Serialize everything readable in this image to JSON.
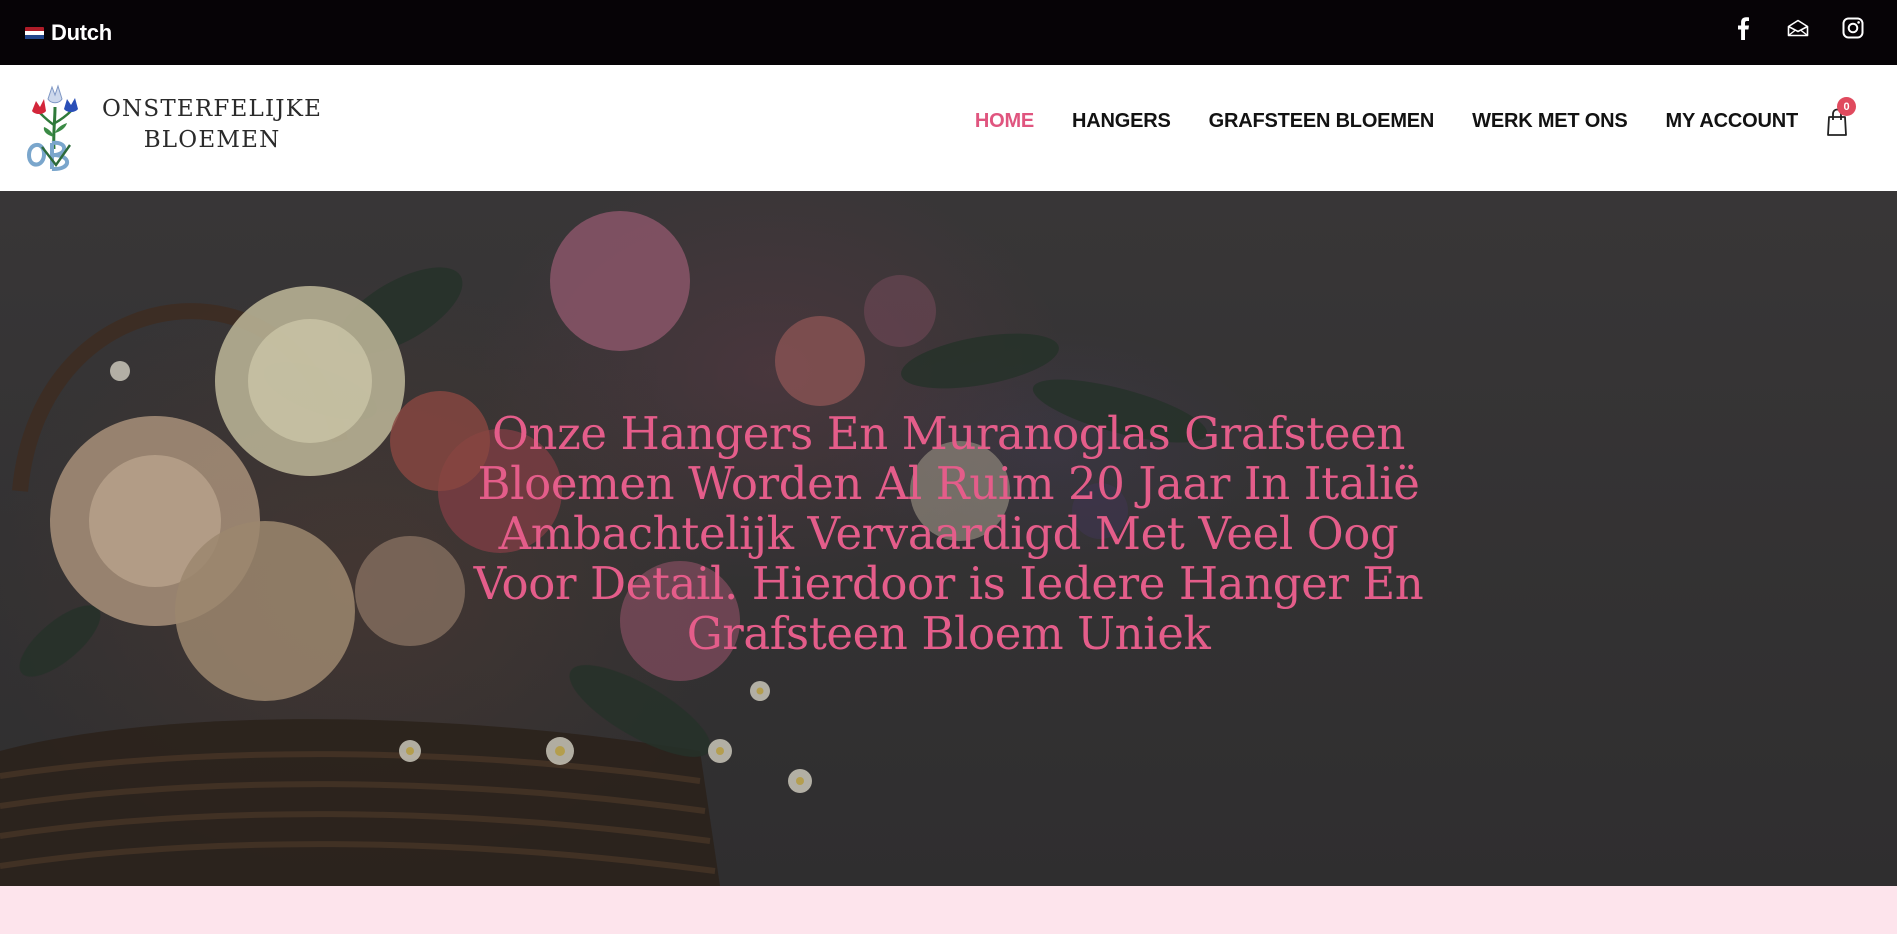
{
  "topbar": {
    "language": "Dutch",
    "flag_colors": [
      "#ae1c28",
      "#ffffff",
      "#21468b"
    ],
    "social_icons": [
      "facebook-icon",
      "mail-icon",
      "instagram-icon"
    ]
  },
  "header": {
    "logo": {
      "line1": "ONSTERFELIJKE",
      "line2": "BLOEMEN",
      "mark_text": "OB"
    },
    "nav": [
      {
        "label": "HOME",
        "active": true
      },
      {
        "label": "HANGERS",
        "active": false
      },
      {
        "label": "GRAFSTEEN BLOEMEN",
        "active": false
      },
      {
        "label": "WERK MET ONS",
        "active": false
      },
      {
        "label": "MY ACCOUNT",
        "active": false
      }
    ],
    "cart": {
      "icon": "shopping-bag-icon",
      "count": "0"
    }
  },
  "hero": {
    "title": "Onze Hangers En Muranoglas Grafsteen Bloemen Worden Al Ruim 20 Jaar In Italië Ambachtelijk Vervaardigd Met Veel Oog Voor Detail. Hierdoor is Iedere Hanger En Grafsteen Bloem Uniek"
  },
  "colors": {
    "accent": "#e0557f",
    "topbar_bg": "#060306",
    "band_bg": "#fde4ec",
    "badge": "#e04a5e"
  }
}
